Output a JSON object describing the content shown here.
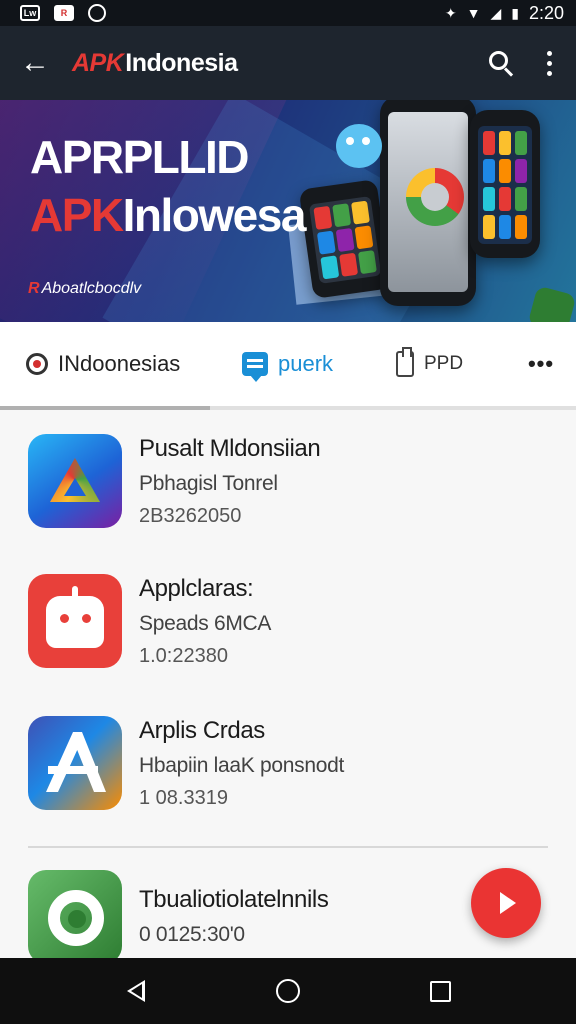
{
  "status_bar": {
    "time": "2:20",
    "icon_labels": [
      "Lw",
      "R"
    ]
  },
  "app_bar": {
    "title_prefix": "APK",
    "title_rest": "Indonesia"
  },
  "banner": {
    "line1": "APRPLLID",
    "line2_red": "APK",
    "line2_white": "Inlowesa",
    "sub_mark": "R",
    "sub_text": "Aboatlcbocdlv"
  },
  "tabs": [
    {
      "label": "INdoonesias",
      "icon": "user-location-icon"
    },
    {
      "label": "puerk",
      "icon": "chat-icon"
    },
    {
      "label": "PPD",
      "icon": "clipboard-icon"
    },
    {
      "label": "•••",
      "icon": "more-icon"
    }
  ],
  "apps": [
    {
      "title": "Pusalt Mldonsiian",
      "subtitle": "Pbhagisl Tonrel",
      "meta": "2B3262050",
      "icon": "triangle-logo-icon"
    },
    {
      "title": "Applclaras:",
      "subtitle": "Speads 6MCA",
      "meta": "1.0:22380",
      "icon": "robot-face-icon"
    },
    {
      "title": "Arplis Crdas",
      "subtitle": "Hbapiin laaK ponsnodt",
      "meta": "1 08.3319",
      "icon": "a-letter-logo-icon"
    },
    {
      "title": "Tbualiotiolatelnnils",
      "subtitle": "0 0125:30'0",
      "meta": "",
      "icon": "green-ring-icon"
    }
  ],
  "colors": {
    "accent_red": "#e53935",
    "tab_active_blue": "#1a8fd6",
    "app_bar": "#1e252e"
  }
}
